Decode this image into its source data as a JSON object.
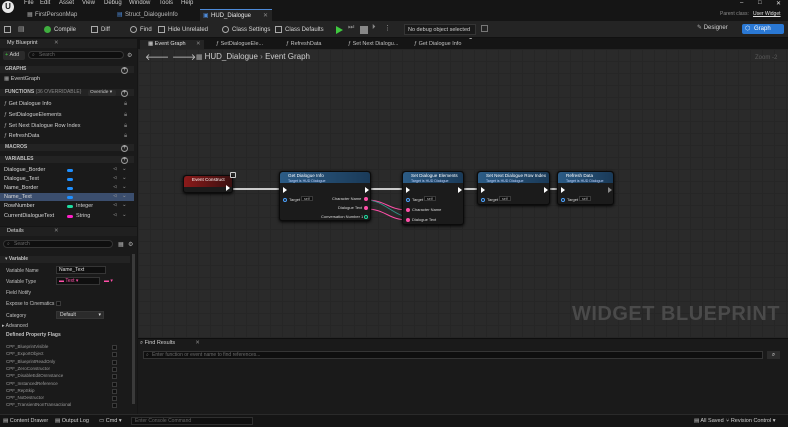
{
  "menubar": {
    "items": [
      "File",
      "Edit",
      "Asset",
      "View",
      "Debug",
      "Window",
      "Tools",
      "Help"
    ],
    "parent_class_label": "Parent class:",
    "parent_class": "User Widget"
  },
  "tabs": [
    {
      "label": "FirstPersonMap"
    },
    {
      "label": "Struct_DialogueInfo"
    },
    {
      "label": "HUD_Dialogue"
    }
  ],
  "toolbar": {
    "compile": "Compile",
    "diff": "Diff",
    "find": "Find",
    "hide_unrelated": "Hide Unrelated",
    "class_settings": "Class Settings",
    "class_defaults": "Class Defaults",
    "debug_select": "No debug object selected",
    "designer": "Designer",
    "graph": "Graph"
  },
  "my_blueprint": {
    "title": "My Blueprint",
    "add": "Add",
    "search_placeholder": "Search",
    "graphs_header": "GRAPHS",
    "graphs": [
      "EventGraph"
    ],
    "functions_header": "FUNCTIONS",
    "functions_note": "(36 OVERRIDABLE)",
    "override": "Override",
    "functions": [
      "Get Dialogue Info",
      "SetDialogueElements",
      "Set Next Dialogue Row Index",
      "RefreshData"
    ],
    "macros_header": "MACROS",
    "variables_header": "VARIABLES",
    "variables": [
      {
        "name": "Dialogue_Border",
        "type": "",
        "color": "#1e8fff"
      },
      {
        "name": "Dialogue_Text",
        "type": "",
        "color": "#1e8fff"
      },
      {
        "name": "Name_Border",
        "type": "",
        "color": "#1e8fff"
      },
      {
        "name": "Name_Text",
        "type": "",
        "color": "#1e8fff"
      },
      {
        "name": "RowNumber",
        "type": "Integer",
        "color": "#1edca0"
      },
      {
        "name": "CurrentDialogueText",
        "type": "String",
        "color": "#ff1ec8"
      }
    ]
  },
  "details": {
    "title": "Details",
    "search_placeholder": "Search",
    "variable_header": "Variable",
    "variable_name_label": "Variable Name",
    "variable_name": "Name_Text",
    "variable_type_label": "Variable Type",
    "variable_type": "Text",
    "field_notify_label": "Field Notify",
    "expose_label": "Expose to Cinematics",
    "category_label": "Category",
    "category": "Default",
    "advanced_label": "Advanced",
    "property_flags_label": "Defined Property Flags",
    "flags": [
      "CPF_BlueprintVisible",
      "CPF_ExportObject",
      "CPF_BlueprintReadOnly",
      "CPF_ZeroConstructor",
      "CPF_DisableEditOnInstance",
      "CPF_InstancedReference",
      "CPF_RepSkip",
      "CPF_NoDestructor",
      "CPF_TransientNonTransactional"
    ]
  },
  "graph_tabs": [
    "Event Graph",
    "SetDialogueEle...",
    "RefreshData",
    "Set Next Dialogu...",
    "Get Dialogue Info"
  ],
  "breadcrumb": {
    "blueprint": "HUD_Dialogue",
    "graph": "Event Graph"
  },
  "zoom": "Zoom -2",
  "watermark": "WIDGET BLUEPRINT",
  "nodes": {
    "event": {
      "title": "Event Construct"
    },
    "get_info": {
      "title": "Get Dialogue Info",
      "subtitle": "Target is HUD Dialogue",
      "target": "Target",
      "self": "self",
      "out1": "Character Name",
      "out2": "Dialogue Text",
      "out3": "Conversation Number 1"
    },
    "set_elements": {
      "title": "Set Dialogue Elements",
      "subtitle": "Target is HUD Dialogue",
      "target": "Target",
      "self": "self",
      "in1": "Character Name",
      "in2": "Dialogue Text"
    },
    "set_next": {
      "title": "Set Next Dialogue Row Index",
      "subtitle": "Target is HUD Dialogue",
      "target": "Target",
      "self": "self"
    },
    "refresh": {
      "title": "Refresh Data",
      "subtitle": "Target is HUD Dialogue",
      "target": "Target",
      "self": "self"
    }
  },
  "find_results": {
    "title": "Find Results",
    "placeholder": "Enter function or event name to find references..."
  },
  "statusbar": {
    "content_drawer": "Content Drawer",
    "output_log": "Output Log",
    "cmd": "Cmd",
    "console_placeholder": "Enter Console Command",
    "all_saved": "All Saved",
    "revision_control": "Revision Control"
  }
}
